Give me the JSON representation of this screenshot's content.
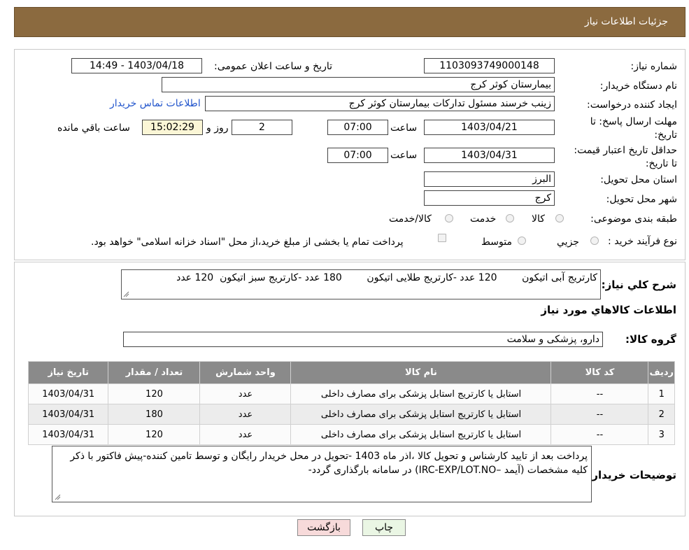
{
  "header": {
    "title": "جزئیات اطلاعات نیاز"
  },
  "form": {
    "need_number_label": "شماره نیاز:",
    "need_number": "1103093749000148",
    "announce_label": "تاریخ و ساعت اعلان عمومی:",
    "announce_value": "1403/04/18 - 14:49",
    "buyer_org_label": "نام دستگاه خریدار:",
    "buyer_org": "بیمارستان کوثر کرج",
    "creator_label": "ایجاد کننده درخواست:",
    "creator": "زینب خرسند مسئول تدارکات بیمارستان کوثر کرج",
    "contact_link": "اطلاعات تماس خریدار",
    "deadline_label": "مهلت ارسال پاسخ: تا تاریخ:",
    "deadline_date": "1403/04/21",
    "time_label": "ساعت",
    "deadline_time": "07:00",
    "days_value": "2",
    "days_label": "روز و",
    "remaining_time": "15:02:29",
    "remaining_label": "ساعت باقي مانده",
    "validity_label": "حداقل تاریخ اعتبار قیمت: تا تاریخ:",
    "validity_date": "1403/04/31",
    "validity_time": "07:00",
    "province_label": "استان محل تحویل:",
    "province": "البرز",
    "city_label": "شهر محل تحویل:",
    "city": "کرج",
    "category_label": "طبقه بندی موضوعی:",
    "category_options": [
      "کالا",
      "خدمت",
      "کالا/خدمت"
    ],
    "process_label": "نوع فرآیند خرید :",
    "process_options": [
      "جزیي",
      "متوسط"
    ],
    "process_note": "پرداخت تمام یا بخشی از مبلغ خرید،از محل \"اسناد خزانه اسلامی\" خواهد بود."
  },
  "summary": {
    "label": "شرح كلي نياز:",
    "text": "کارتریج آبی اتیکون        120 عدد -کارتریج طلایی اتیکون        180 عدد -کارتریج سبز اتیکون  120 عدد"
  },
  "goods_section": {
    "title": "اطلاعات كالاهاي مورد نياز",
    "group_label": "گروه كالا:",
    "group_value": "دارو، پزشکی و سلامت"
  },
  "table": {
    "headers": [
      "رديف",
      "كد كالا",
      "نام كالا",
      "واحد شمارش",
      "تعداد / مقدار",
      "تاريخ نياز"
    ],
    "rows": [
      [
        "1",
        "--",
        "استابل یا کارتریج استابل پزشکی برای مصارف داخلی",
        "عدد",
        "120",
        "1403/04/31"
      ],
      [
        "2",
        "--",
        "استابل یا کارتریج استابل پزشکی برای مصارف داخلی",
        "عدد",
        "180",
        "1403/04/31"
      ],
      [
        "3",
        "--",
        "استابل یا کارتریج استابل پزشکی برای مصارف داخلی",
        "عدد",
        "120",
        "1403/04/31"
      ]
    ]
  },
  "buyer_notes": {
    "label": "توضیحات خریدار:",
    "text": "پرداخت بعد از تایید کارشناس و تحویل کالا ،اذر ماه 1403 -تحویل در محل خریدار رایگان و توسط تامین کننده-پیش فاکتور با ذکر کلیه مشخصات (آیمد –IRC-EXP/LOT.NO) در سامانه بارگذاری گردد-"
  },
  "buttons": {
    "print": "چاپ",
    "back": "بازگشت"
  },
  "colors": {
    "header_bg": "#8b6a3f",
    "table_header_bg": "#8a8a8a",
    "print_btn_bg": "#eaf6e4",
    "back_btn_bg": "#f7dada",
    "link": "#2255cc"
  }
}
